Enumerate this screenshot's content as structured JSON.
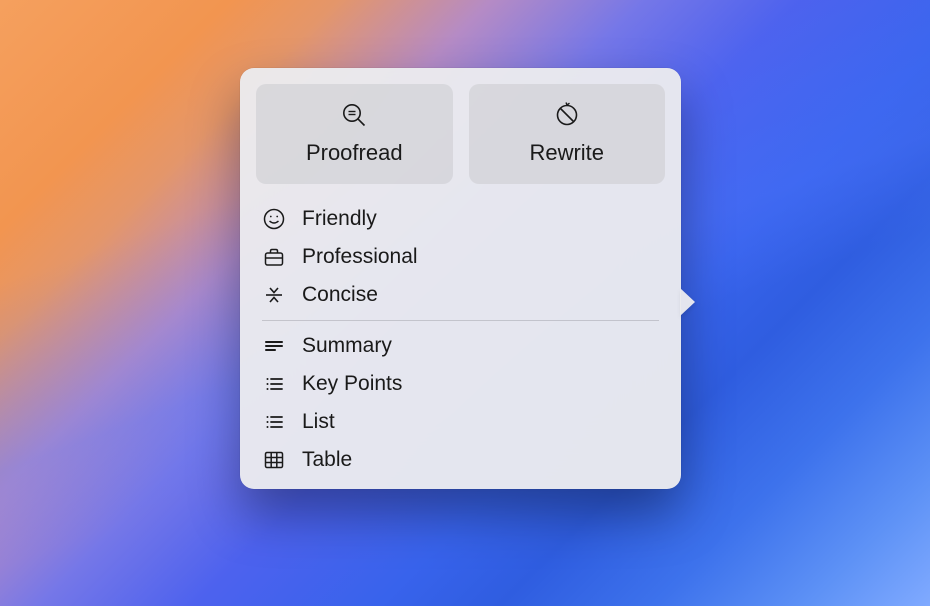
{
  "primary_actions": {
    "proofread": {
      "label": "Proofread"
    },
    "rewrite": {
      "label": "Rewrite"
    }
  },
  "tone_items": [
    {
      "id": "friendly",
      "label": "Friendly",
      "icon": "smiley-icon"
    },
    {
      "id": "professional",
      "label": "Professional",
      "icon": "briefcase-icon"
    },
    {
      "id": "concise",
      "label": "Concise",
      "icon": "compress-icon"
    }
  ],
  "format_items": [
    {
      "id": "summary",
      "label": "Summary",
      "icon": "paragraph-icon"
    },
    {
      "id": "keypoints",
      "label": "Key Points",
      "icon": "bullet-list-icon"
    },
    {
      "id": "list",
      "label": "List",
      "icon": "bullet-list-icon"
    },
    {
      "id": "table",
      "label": "Table",
      "icon": "table-icon"
    }
  ]
}
